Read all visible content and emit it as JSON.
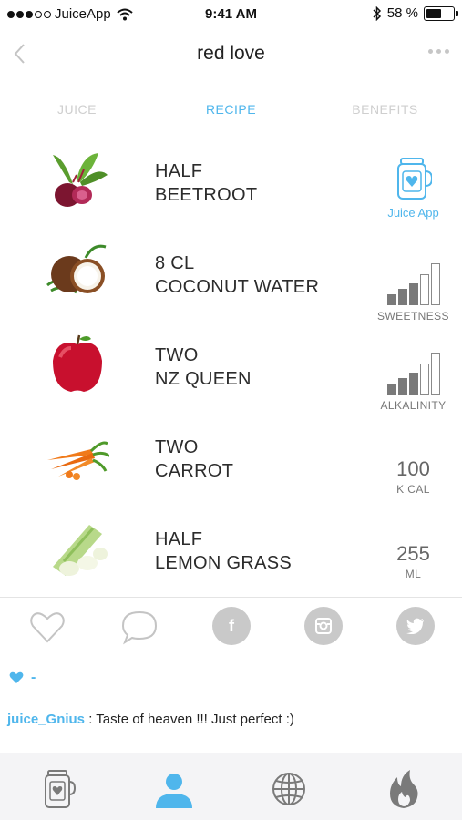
{
  "status_bar": {
    "carrier": "JuiceApp",
    "time": "9:41 AM",
    "battery": "58 %",
    "battery_level": 0.58
  },
  "nav": {
    "title": "red love"
  },
  "tabs": [
    {
      "label": "JUICE",
      "active": false
    },
    {
      "label": "RECIPE",
      "active": true
    },
    {
      "label": "BENEFITS",
      "active": false
    }
  ],
  "ingredients": [
    {
      "line1": "HALF",
      "line2": "BEETROOT",
      "icon": "beetroot-image"
    },
    {
      "line1": "8 CL",
      "line2": "COCONUT WATER",
      "icon": "coconut-image"
    },
    {
      "line1": "TWO",
      "line2": "NZ QUEEN",
      "icon": "apple-image"
    },
    {
      "line1": "TWO",
      "line2": "CARROT",
      "icon": "carrot-image"
    },
    {
      "line1": "HALF",
      "line2": "LEMON GRASS",
      "icon": "lemongrass-image"
    }
  ],
  "info": {
    "app_label": "Juice App",
    "sweetness_label": "SWEETNESS",
    "sweetness_level": 3,
    "alkalinity_label": "ALKALINITY",
    "alkalinity_level": 3,
    "bars_total": 5,
    "calories_value": "100",
    "calories_unit": "K CAL",
    "volume_value": "255",
    "volume_unit": "ML"
  },
  "likes": {
    "count": "-"
  },
  "comment": {
    "user": "juice_Gnius",
    "text": " : Taste of heaven !!! Just perfect :)"
  },
  "colors": {
    "accent": "#4fb6ec",
    "inactive_tab": "#cfcfcf",
    "social_grey": "#c9c9c9"
  }
}
